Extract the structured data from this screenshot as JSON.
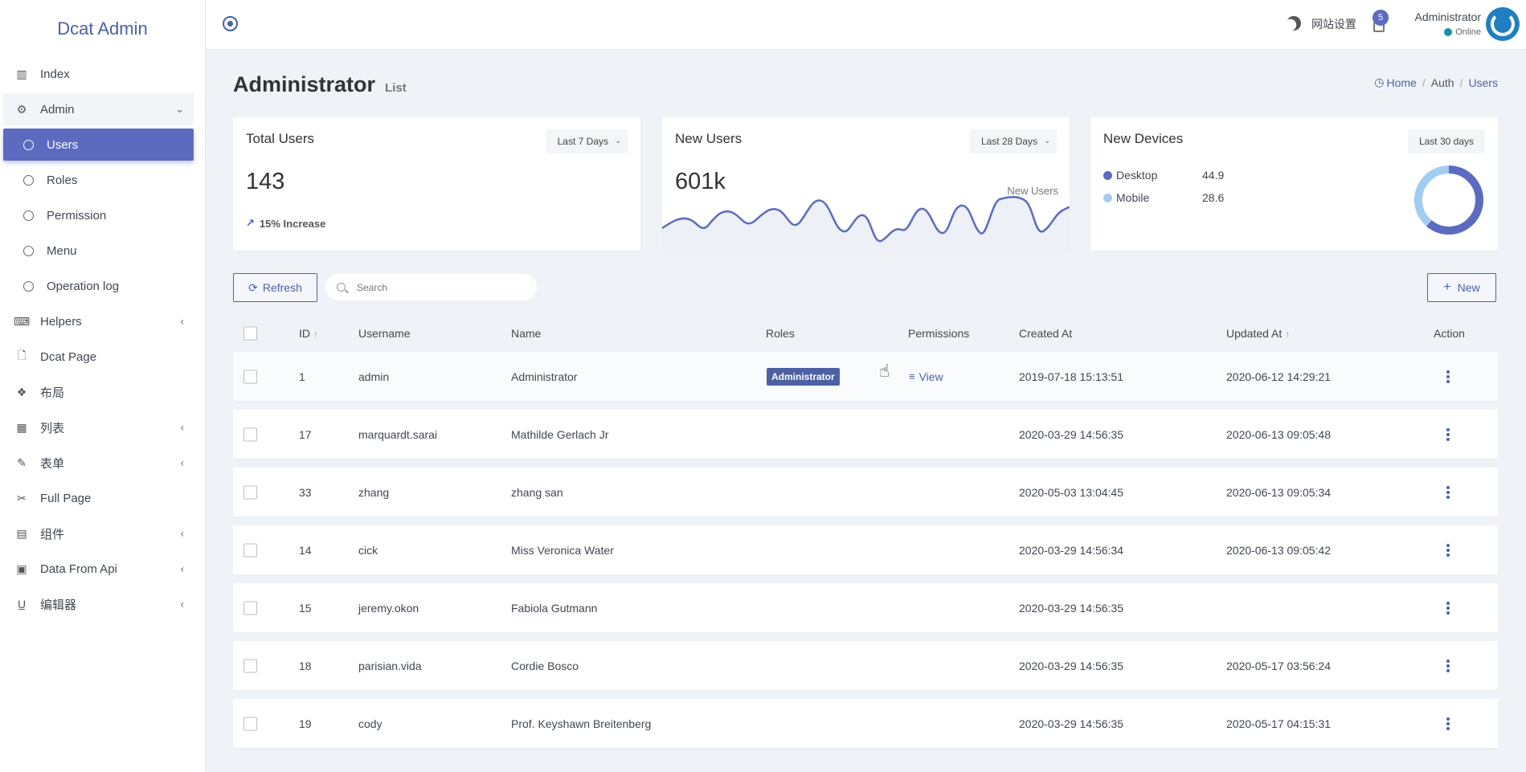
{
  "brand": "Dcat Admin",
  "sidebar": {
    "items": [
      {
        "label": "Index",
        "icon": "bar-chart-icon",
        "glyph": "▥",
        "caret": ""
      },
      {
        "label": "Admin",
        "icon": "gear-icon",
        "glyph": "⚙",
        "caret": "⌄"
      },
      {
        "label": "Users",
        "icon": "circle-icon",
        "glyph": "",
        "caret": ""
      },
      {
        "label": "Roles",
        "icon": "circle-icon",
        "glyph": "",
        "caret": ""
      },
      {
        "label": "Permission",
        "icon": "circle-icon",
        "glyph": "",
        "caret": ""
      },
      {
        "label": "Menu",
        "icon": "circle-icon",
        "glyph": "",
        "caret": ""
      },
      {
        "label": "Operation log",
        "icon": "circle-icon",
        "glyph": "",
        "caret": ""
      },
      {
        "label": "Helpers",
        "icon": "keyboard-icon",
        "glyph": "⌨",
        "caret": "‹"
      },
      {
        "label": "Dcat Page",
        "icon": "file-icon",
        "glyph": "🗋",
        "caret": ""
      },
      {
        "label": "布局",
        "icon": "cubes-icon",
        "glyph": "❖",
        "caret": ""
      },
      {
        "label": "列表",
        "icon": "grid-icon",
        "glyph": "▦",
        "caret": "‹"
      },
      {
        "label": "表单",
        "icon": "edit-icon",
        "glyph": "✎",
        "caret": "‹"
      },
      {
        "label": "Full Page",
        "icon": "scissors-icon",
        "glyph": "✂",
        "caret": ""
      },
      {
        "label": "组件",
        "icon": "building-icon",
        "glyph": "▤",
        "caret": "‹"
      },
      {
        "label": "Data From Api",
        "icon": "film-icon",
        "glyph": "▣",
        "caret": "‹"
      },
      {
        "label": "编辑器",
        "icon": "underline-icon",
        "glyph": "U̲",
        "caret": "‹"
      }
    ]
  },
  "topbar": {
    "settings_label": "网站设置",
    "notification_count": "5",
    "user_name": "Administrator",
    "user_status": "Online"
  },
  "page": {
    "title": "Administrator",
    "subtitle": "List",
    "breadcrumb": [
      "Home",
      "Auth",
      "Users"
    ]
  },
  "cards": {
    "total_users": {
      "title": "Total Users",
      "range": "Last 7 Days",
      "value": "143",
      "change": "15% Increase"
    },
    "new_users": {
      "title": "New Users",
      "range": "Last 28 Days",
      "value": "601k",
      "legend": "New Users"
    },
    "new_devices": {
      "title": "New Devices",
      "range": "Last 30 days",
      "items": [
        {
          "label": "Desktop",
          "value": "44.9",
          "color": "#5c6bc0"
        },
        {
          "label": "Mobile",
          "value": "28.6",
          "color": "#a3cdf0"
        }
      ]
    }
  },
  "toolbar": {
    "refresh_label": "Refresh",
    "search_placeholder": "Search",
    "new_label": "New"
  },
  "table": {
    "headers": {
      "id": "ID",
      "username": "Username",
      "name": "Name",
      "roles": "Roles",
      "permissions": "Permissions",
      "created_at": "Created At",
      "updated_at": "Updated At",
      "action": "Action"
    },
    "rows": [
      {
        "id": "1",
        "username": "admin",
        "name": "Administrator",
        "role": "Administrator",
        "permissions": "View",
        "created": "2019-07-18 15:13:51",
        "updated": "2020-06-12 14:29:21"
      },
      {
        "id": "17",
        "username": "marquardt.sarai",
        "name": "Mathilde Gerlach Jr",
        "role": "",
        "permissions": "",
        "created": "2020-03-29 14:56:35",
        "updated": "2020-06-13 09:05:48"
      },
      {
        "id": "33",
        "username": "zhang",
        "name": "zhang san",
        "role": "",
        "permissions": "",
        "created": "2020-05-03 13:04:45",
        "updated": "2020-06-13 09:05:34"
      },
      {
        "id": "14",
        "username": "cick",
        "name": "Miss Veronica Water",
        "role": "",
        "permissions": "",
        "created": "2020-03-29 14:56:34",
        "updated": "2020-06-13 09:05:42"
      },
      {
        "id": "15",
        "username": "jeremy.okon",
        "name": "Fabiola Gutmann",
        "role": "",
        "permissions": "",
        "created": "2020-03-29 14:56:35",
        "updated": ""
      },
      {
        "id": "18",
        "username": "parisian.vida",
        "name": "Cordie Bosco",
        "role": "",
        "permissions": "",
        "created": "2020-03-29 14:56:35",
        "updated": "2020-05-17 03:56:24"
      },
      {
        "id": "19",
        "username": "cody",
        "name": "Prof. Keyshawn Breitenberg",
        "role": "",
        "permissions": "",
        "created": "2020-03-29 14:56:35",
        "updated": "2020-05-17 04:15:31"
      }
    ]
  },
  "colors": {
    "accent": "#4c60a3",
    "active": "#5c6bc0",
    "background": "#eff3f8"
  }
}
